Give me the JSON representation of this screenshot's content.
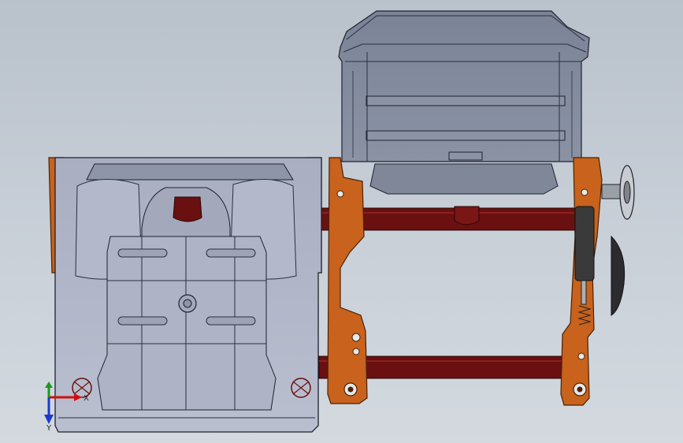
{
  "viewport": {
    "background_top": "#b9c1cb",
    "background_bottom": "#d3d9df"
  },
  "model": {
    "parts": [
      {
        "id": "seat-cushion",
        "color": "#aab0c2"
      },
      {
        "id": "seat-backrest",
        "color": "#7f8799"
      },
      {
        "id": "frame-bracket",
        "color": "#c8621c"
      },
      {
        "id": "crossbar",
        "color": "#6a1010"
      },
      {
        "id": "gas-spring",
        "color": "#3a3a3a"
      },
      {
        "id": "adjust-knob",
        "color": "#9aa0a8"
      }
    ]
  },
  "triad": {
    "x_label": "X",
    "y_label": "Y",
    "x_color": "#d01010",
    "y_color": "#1a3ad0",
    "z_color": "#1a9a1a"
  }
}
